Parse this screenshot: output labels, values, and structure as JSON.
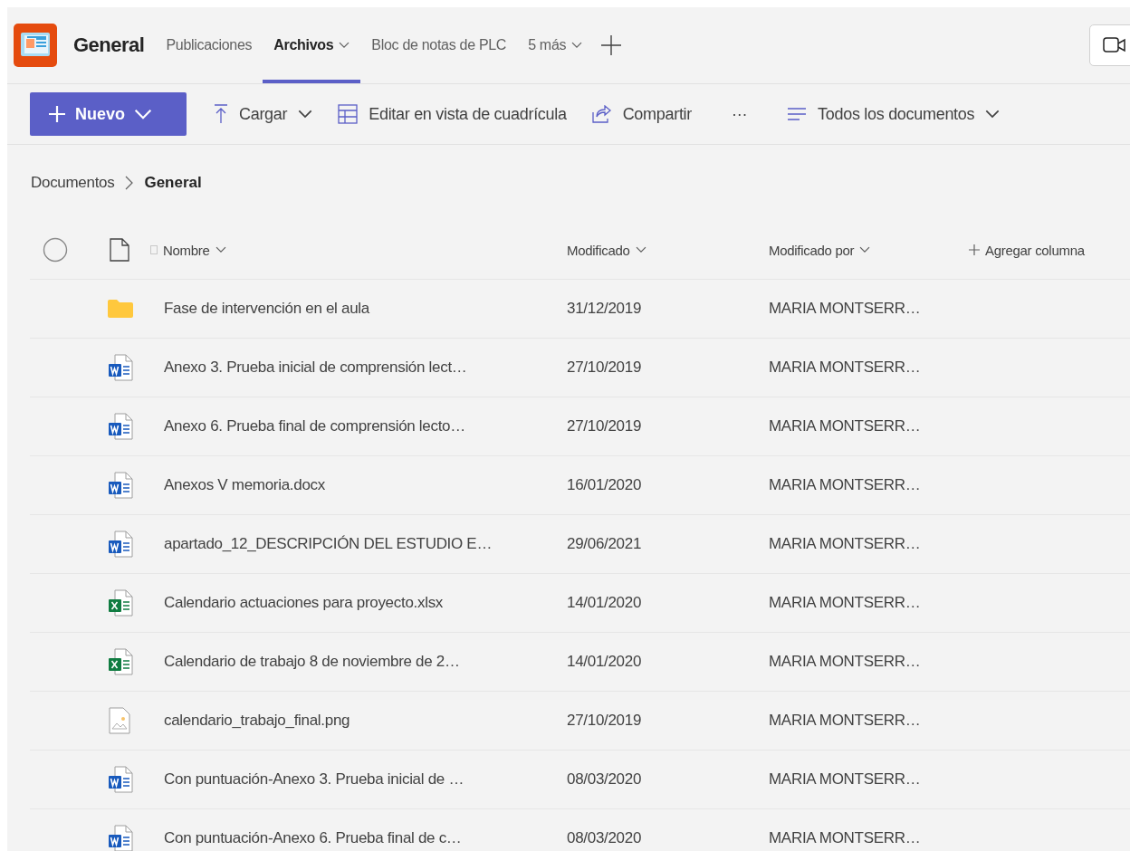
{
  "header": {
    "channel": "General",
    "tabs": [
      {
        "label": "Publicaciones",
        "selected": false,
        "dropdown": false
      },
      {
        "label": "Archivos",
        "selected": true,
        "dropdown": true
      },
      {
        "label": "Bloc de notas de PLC",
        "selected": false,
        "dropdown": false
      },
      {
        "label": "5 más",
        "selected": false,
        "dropdown": true
      }
    ]
  },
  "toolbar": {
    "new_button": "Nuevo",
    "actions": [
      {
        "kind": "upload",
        "label": "Cargar"
      },
      {
        "kind": "grid",
        "label": "Editar en vista de cuadrícula"
      },
      {
        "kind": "share",
        "label": "Compartir"
      }
    ],
    "more": "···",
    "view": "Todos los documentos"
  },
  "breadcrumb": {
    "parent": "Documentos",
    "current": "General"
  },
  "table": {
    "columns": [
      "Nombre",
      "Modificado",
      "Modificado por"
    ],
    "add_column": "Agregar columna",
    "rows": [
      {
        "kind": "folder",
        "name": "Fase de intervención en el aula",
        "modified": "31/12/2019",
        "modified_by": "MARIA MONTSERR…"
      },
      {
        "kind": "word",
        "name": "Anexo 3. Prueba inicial de comprensión lect…",
        "modified": "27/10/2019",
        "modified_by": "MARIA MONTSERR…"
      },
      {
        "kind": "word",
        "name": "Anexo 6. Prueba final de comprensión lecto…",
        "modified": "27/10/2019",
        "modified_by": "MARIA MONTSERR…"
      },
      {
        "kind": "word",
        "name": "Anexos V memoria.docx",
        "modified": "16/01/2020",
        "modified_by": "MARIA MONTSERR…"
      },
      {
        "kind": "word",
        "name": "apartado_12_DESCRIPCIÓN DEL ESTUDIO E…",
        "modified": "29/06/2021",
        "modified_by": "MARIA MONTSERR…"
      },
      {
        "kind": "excel",
        "name": "Calendario actuaciones para proyecto.xlsx",
        "modified": "14/01/2020",
        "modified_by": "MARIA MONTSERR…"
      },
      {
        "kind": "excel",
        "name": "Calendario de trabajo 8 de noviembre de 2…",
        "modified": "14/01/2020",
        "modified_by": "MARIA MONTSERR…"
      },
      {
        "kind": "image",
        "name": "calendario_trabajo_final.png",
        "modified": "27/10/2019",
        "modified_by": "MARIA MONTSERR…"
      },
      {
        "kind": "word",
        "name": "Con puntuación-Anexo 3. Prueba inicial de …",
        "modified": "08/03/2020",
        "modified_by": "MARIA MONTSERR…"
      },
      {
        "kind": "word",
        "name": "Con puntuación-Anexo 6. Prueba final de c…",
        "modified": "08/03/2020",
        "modified_by": "MARIA MONTSERR…"
      }
    ]
  }
}
